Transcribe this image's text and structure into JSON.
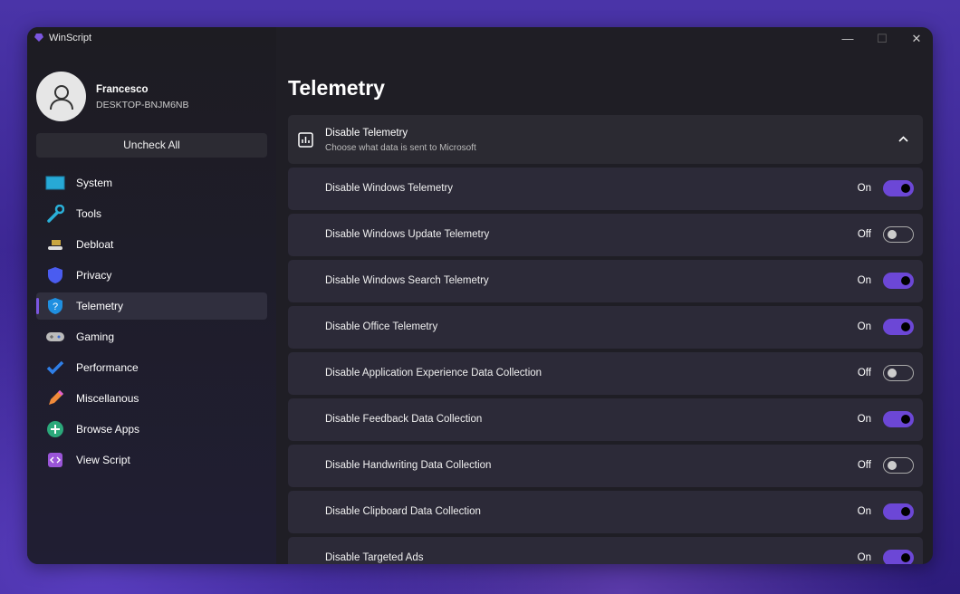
{
  "window": {
    "title": "WinScript",
    "minimize": "—",
    "maximize": "☐",
    "close": "✕"
  },
  "user": {
    "name": "Francesco",
    "host": "DESKTOP-BNJM6NB"
  },
  "sidebar": {
    "uncheck_all": "Uncheck All",
    "items": [
      {
        "label": "System",
        "icon": "monitor-icon"
      },
      {
        "label": "Tools",
        "icon": "wrench-icon"
      },
      {
        "label": "Debloat",
        "icon": "broom-icon"
      },
      {
        "label": "Privacy",
        "icon": "shield-icon"
      },
      {
        "label": "Telemetry",
        "icon": "shield-question-icon",
        "active": true
      },
      {
        "label": "Gaming",
        "icon": "gamepad-icon"
      },
      {
        "label": "Performance",
        "icon": "checkmark-icon"
      },
      {
        "label": "Miscellanous",
        "icon": "pencil-icon"
      },
      {
        "label": "Browse Apps",
        "icon": "plus-circle-icon"
      },
      {
        "label": "View Script",
        "icon": "code-icon"
      }
    ]
  },
  "main": {
    "title": "Telemetry",
    "section": {
      "title": "Disable Telemetry",
      "subtitle": "Choose what data is sent to Microsoft",
      "expanded": true
    },
    "options": [
      {
        "label": "Disable Windows Telemetry",
        "state": "On"
      },
      {
        "label": "Disable Windows Update Telemetry",
        "state": "Off"
      },
      {
        "label": "Disable Windows Search Telemetry",
        "state": "On"
      },
      {
        "label": "Disable Office Telemetry",
        "state": "On"
      },
      {
        "label": "Disable Application Experience Data Collection",
        "state": "Off"
      },
      {
        "label": "Disable Feedback Data Collection",
        "state": "On"
      },
      {
        "label": "Disable Handwriting Data Collection",
        "state": "Off"
      },
      {
        "label": "Disable Clipboard Data Collection",
        "state": "On"
      },
      {
        "label": "Disable Targeted Ads",
        "state": "On"
      }
    ]
  },
  "colors": {
    "accent": "#6c47d6"
  }
}
